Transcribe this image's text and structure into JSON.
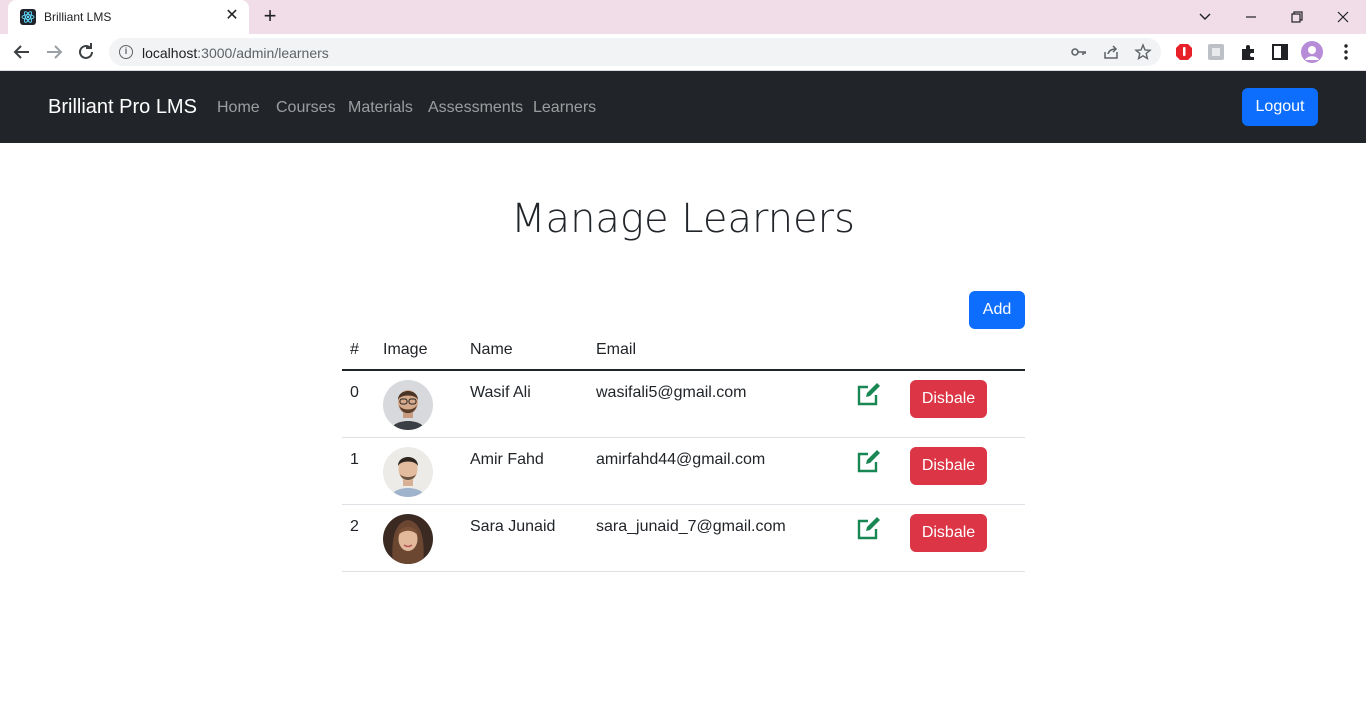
{
  "browser": {
    "tab_title": "Brilliant LMS",
    "url_host": "localhost",
    "url_rest": ":3000/admin/learners"
  },
  "navbar": {
    "brand": "Brilliant Pro LMS",
    "links": [
      "Home",
      "Courses",
      "Materials",
      "Assessments",
      "Learners"
    ],
    "logout_label": "Logout"
  },
  "main": {
    "title": "Manage Learners",
    "add_label": "Add",
    "table": {
      "headers": [
        "#",
        "Image",
        "Name",
        "Email"
      ],
      "rows": [
        {
          "index": "0",
          "name": "Wasif Ali",
          "email": "wasifali5@gmail.com",
          "action_label": "Disbale"
        },
        {
          "index": "1",
          "name": "Amir Fahd",
          "email": "amirfahd44@gmail.com",
          "action_label": "Disbale"
        },
        {
          "index": "2",
          "name": "Sara Junaid",
          "email": "sara_junaid_7@gmail.com",
          "action_label": "Disbale"
        }
      ]
    }
  },
  "colors": {
    "navbar_bg": "#212529",
    "primary": "#0d6efd",
    "danger": "#dc3545",
    "edit_icon": "#198754"
  },
  "icons": [
    "react-favicon",
    "close-icon",
    "plus-icon",
    "back-arrow-icon",
    "forward-arrow-icon",
    "reload-icon",
    "info-icon",
    "key-icon",
    "share-icon",
    "star-icon",
    "extension-icon",
    "sidebar-icon",
    "profile-icon",
    "menu-dots-icon",
    "edit-icon"
  ]
}
